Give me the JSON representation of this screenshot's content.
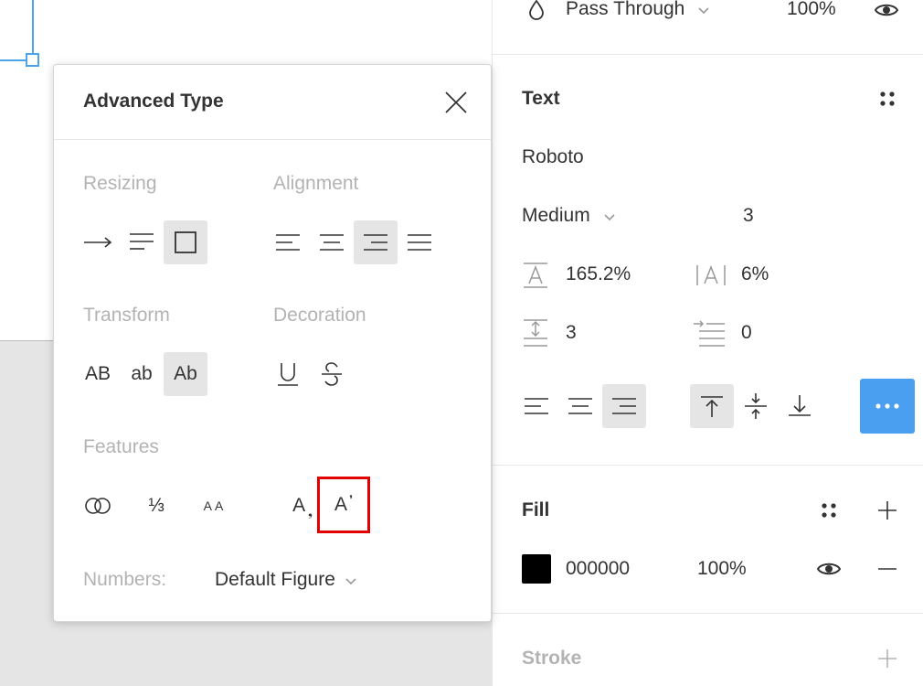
{
  "layer": {
    "blend_mode": "Pass Through",
    "opacity": "100%"
  },
  "text_section": {
    "title": "Text",
    "font_family": "Roboto",
    "font_weight": "Medium",
    "font_size": "3",
    "line_height": "165.2%",
    "letter_spacing": "6%",
    "paragraph_spacing": "3",
    "paragraph_indent": "0"
  },
  "fill_section": {
    "title": "Fill",
    "color_hex": "000000",
    "swatch_color": "#000000",
    "opacity": "100%"
  },
  "stroke_section": {
    "title": "Stroke"
  },
  "advanced_type": {
    "title": "Advanced Type",
    "resizing_label": "Resizing",
    "alignment_label": "Alignment",
    "transform_label": "Transform",
    "decoration_label": "Decoration",
    "features_label": "Features",
    "transform_options": {
      "upper": "AB",
      "lower": "ab",
      "title": "Ab"
    },
    "features": {
      "fractions": "⅓",
      "small_caps": "AA",
      "subscript_base": "A",
      "superscript_base": "A"
    },
    "numbers_label": "Numbers:",
    "numbers_value": "Default Figure"
  },
  "colors": {
    "accent_blue": "#4a9ff0",
    "selection_blue": "#4ea3e8",
    "highlight_red": "#e30000",
    "selected_bg": "#e5e5e5"
  }
}
